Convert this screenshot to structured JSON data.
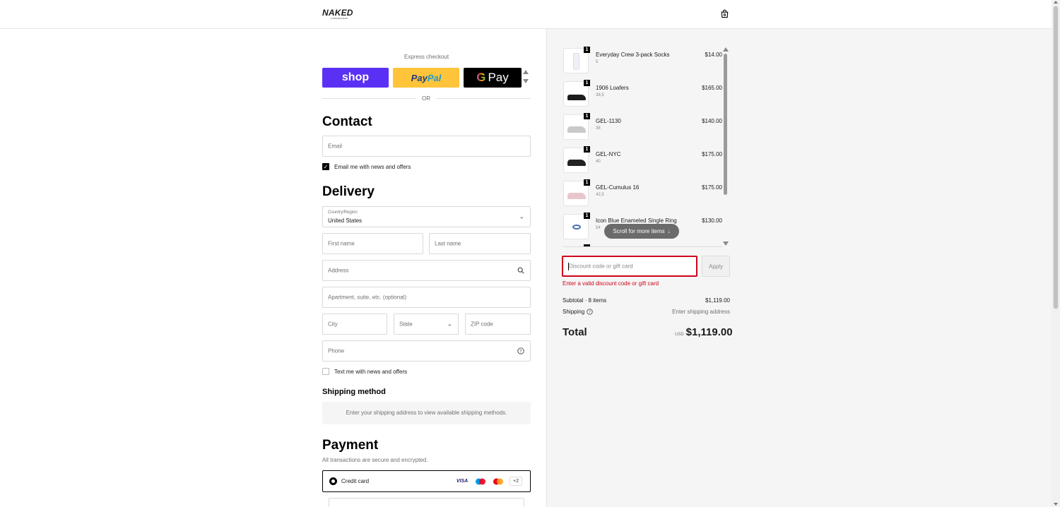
{
  "header": {
    "logo": "NAKED",
    "logo_sub": "COPENHAGEN",
    "cart_icon": "shopping-bag-icon"
  },
  "express": {
    "title": "Express checkout",
    "shop_label": "shop",
    "paypal_label_a": "Pay",
    "paypal_label_b": "Pal",
    "gpay_g": "G",
    "gpay_label": "Pay",
    "or": "OR"
  },
  "contact": {
    "heading": "Contact",
    "email_placeholder": "Email",
    "newsletter_label": "Email me with news and offers",
    "newsletter_checked": true
  },
  "delivery": {
    "heading": "Delivery",
    "country_label": "Country/Region",
    "country_value": "United States",
    "first_name": "First name",
    "last_name": "Last name",
    "address": "Address",
    "apartment": "Apartment, suite, etc. (optional)",
    "city": "City",
    "state": "State",
    "zip": "ZIP code",
    "phone": "Phone",
    "sms_label": "Text me with news and offers"
  },
  "shipping": {
    "heading": "Shipping method",
    "message": "Enter your shipping address to view available shipping methods."
  },
  "payment": {
    "heading": "Payment",
    "subtitle": "All transactions are secure and encrypted.",
    "method": "Credit card",
    "cards": [
      "VISA",
      "+2"
    ],
    "brand_colors": {
      "visa": "#1a1f71",
      "maestro_red": "#eb001b",
      "maestro_blue": "#0099df",
      "mastercard_orange": "#f79e1b"
    }
  },
  "summary": {
    "items": [
      {
        "qty": "1",
        "name": "Everyday Crew 3-pack Socks",
        "variant": "5",
        "price": "$14.00"
      },
      {
        "qty": "1",
        "name": "1906 Loafers",
        "variant": "38,5",
        "price": "$165.00"
      },
      {
        "qty": "1",
        "name": "GEL-1130",
        "variant": "38",
        "price": "$140.00"
      },
      {
        "qty": "1",
        "name": "GEL-NYC",
        "variant": "40",
        "price": "$175.00"
      },
      {
        "qty": "1",
        "name": "GEL-Cumulus 16",
        "variant": "42,5",
        "price": "$175.00"
      },
      {
        "qty": "1",
        "name": "Icon Blue Enameled Single Ring",
        "variant": "54",
        "price": "$130.00"
      }
    ],
    "scroll_hint": "Scroll for more items",
    "discount_placeholder": "Discount code or gift card",
    "apply": "Apply",
    "error": "Enter a valid discount code or gift card",
    "subtotal_label": "Subtotal · 8 items",
    "subtotal_value": "$1,119.00",
    "shipping_label": "Shipping",
    "shipping_value": "Enter shipping address",
    "total_label": "Total",
    "total_currency": "USD",
    "total_value": "$1,119.00"
  }
}
